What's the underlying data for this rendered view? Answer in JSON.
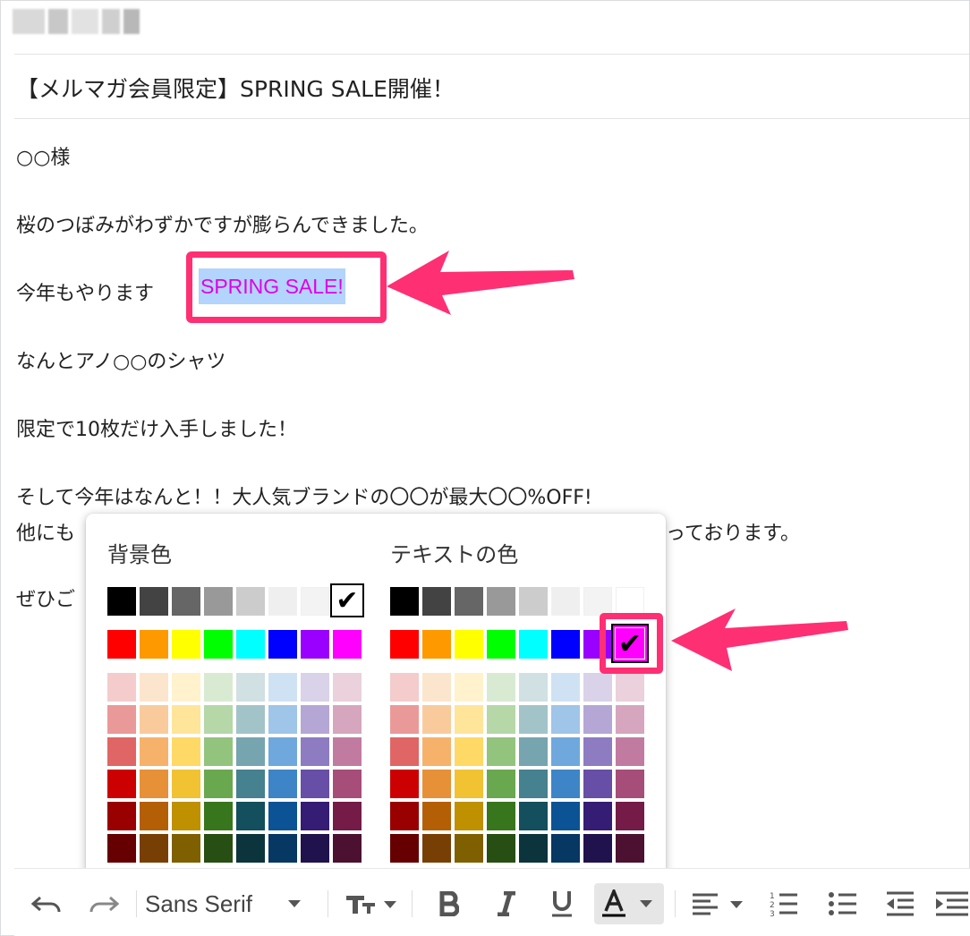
{
  "email": {
    "subject": "【メルマガ会員限定】SPRING SALE開催！",
    "body": {
      "greeting": "○○様",
      "line1": "桜のつぼみがわずかですが膨らんできました。",
      "line2_prefix": "今年もやります",
      "highlight": "SPRING SALE!",
      "line3": "なんとアノ○○のシャツ",
      "line4": "限定で10枚だけ入手しました！",
      "line5": "そして今年はなんと！！大人気ブランドの〇〇が最大〇〇%OFF!",
      "line6_start": "他にも",
      "line6_end": "っております。",
      "line7_start": "ぜひご"
    }
  },
  "color_picker": {
    "background_title": "背景色",
    "text_title": "テキストの色",
    "check_glyph": "✔",
    "selected_background": "#ffffff",
    "selected_text": "#ff00ff",
    "grayscale": [
      "#000000",
      "#434343",
      "#666666",
      "#999999",
      "#cccccc",
      "#efefef",
      "#f3f3f3",
      "#ffffff"
    ],
    "bright": [
      "#ff0000",
      "#ff9900",
      "#ffff00",
      "#00ff00",
      "#00ffff",
      "#0000ff",
      "#9900ff",
      "#ff00ff"
    ],
    "shades": [
      [
        "#f4cccc",
        "#fce5cd",
        "#fff2cc",
        "#d9ead3",
        "#d0e0e3",
        "#cfe2f3",
        "#d9d2e9",
        "#ead1dc"
      ],
      [
        "#ea9999",
        "#f9cb9c",
        "#ffe599",
        "#b6d7a8",
        "#a2c4c9",
        "#9fc5e8",
        "#b4a7d6",
        "#d5a6bd"
      ],
      [
        "#e06666",
        "#f6b26b",
        "#ffd966",
        "#93c47d",
        "#76a5af",
        "#6fa8dc",
        "#8e7cc3",
        "#c27ba0"
      ],
      [
        "#cc0000",
        "#e69138",
        "#f1c232",
        "#6aa84f",
        "#45818e",
        "#3d85c6",
        "#674ea7",
        "#a64d79"
      ],
      [
        "#990000",
        "#b45f06",
        "#bf9000",
        "#38761d",
        "#134f5c",
        "#0b5394",
        "#351c75",
        "#741b47"
      ],
      [
        "#660000",
        "#783f04",
        "#7f6000",
        "#274e13",
        "#0c343d",
        "#073763",
        "#20124d",
        "#4c1130"
      ]
    ]
  },
  "toolbar": {
    "font_name": "Sans Serif",
    "icons": [
      "undo-icon",
      "redo-icon",
      "font-dropdown",
      "text-size-icon",
      "bold-icon",
      "italic-icon",
      "underline-icon",
      "text-color-icon",
      "align-icon",
      "numbered-list-icon",
      "bulleted-list-icon",
      "indent-less-icon",
      "indent-more-icon"
    ]
  },
  "colors": {
    "annotation": "#ff2f74",
    "selection": "#b3d4fc",
    "highlight_text": "#e000e6"
  }
}
